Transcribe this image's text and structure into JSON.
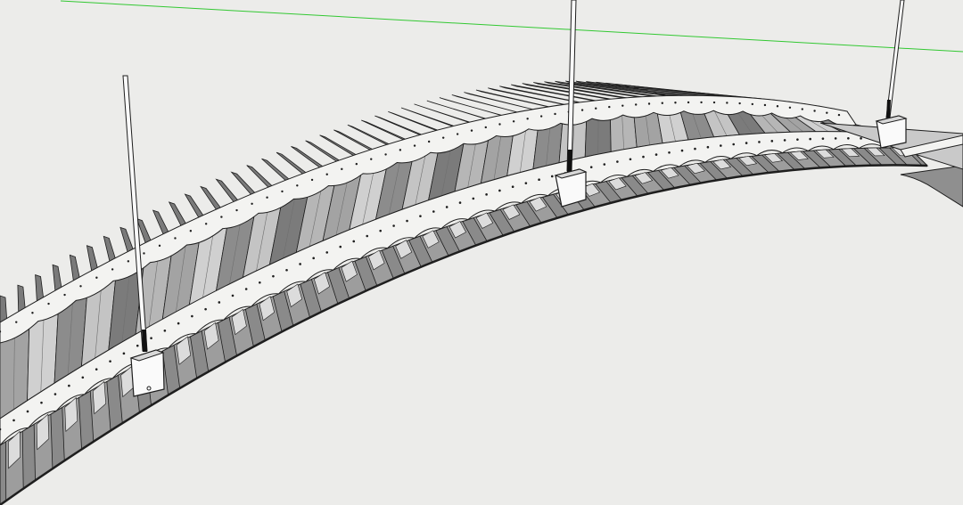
{
  "viewport": {
    "background": "#ececea",
    "horizon_axis_color": "#32c832",
    "edge_color": "#1e1e1e",
    "panel_face_colors": [
      "#a3a3a3",
      "#d0d0d0",
      "#8c8c8c",
      "#c4c4c4",
      "#7b7b7b",
      "#b6b6b6"
    ],
    "side_rail_color": "#f3f3f1",
    "rib_color": "#9d9d9d",
    "hanger_color": "#fafafa"
  },
  "model": {
    "object": "curved-slat-ceiling-canopy",
    "suspension_hangers": 3,
    "hanger_brackets": 3
  }
}
